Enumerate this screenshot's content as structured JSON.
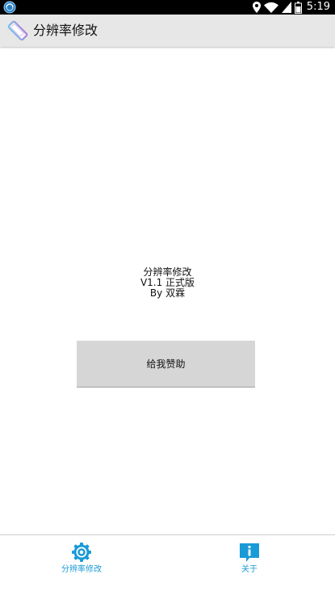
{
  "status_bar": {
    "time": "5:19",
    "app_icon": "app-notification-icon",
    "icons": [
      "location-icon",
      "wifi-icon",
      "signal-icon",
      "battery-icon"
    ]
  },
  "action_bar": {
    "title": "分辨率修改",
    "logo_icon": "rotate-phone-icon"
  },
  "main": {
    "app_name": "分辨率修改",
    "version": "V1.1 正式版",
    "author": "By 双霖",
    "donate_button_label": "给我赞助"
  },
  "bottom_nav": {
    "items": [
      {
        "label": "分辨率修改",
        "icon": "gear-icon"
      },
      {
        "label": "关于",
        "icon": "info-icon"
      }
    ]
  },
  "colors": {
    "accent": "#1a9ad6",
    "action_bar_bg": "#e7e7e7",
    "button_bg": "#d6d6d6",
    "status_bar_bg": "#000000"
  }
}
